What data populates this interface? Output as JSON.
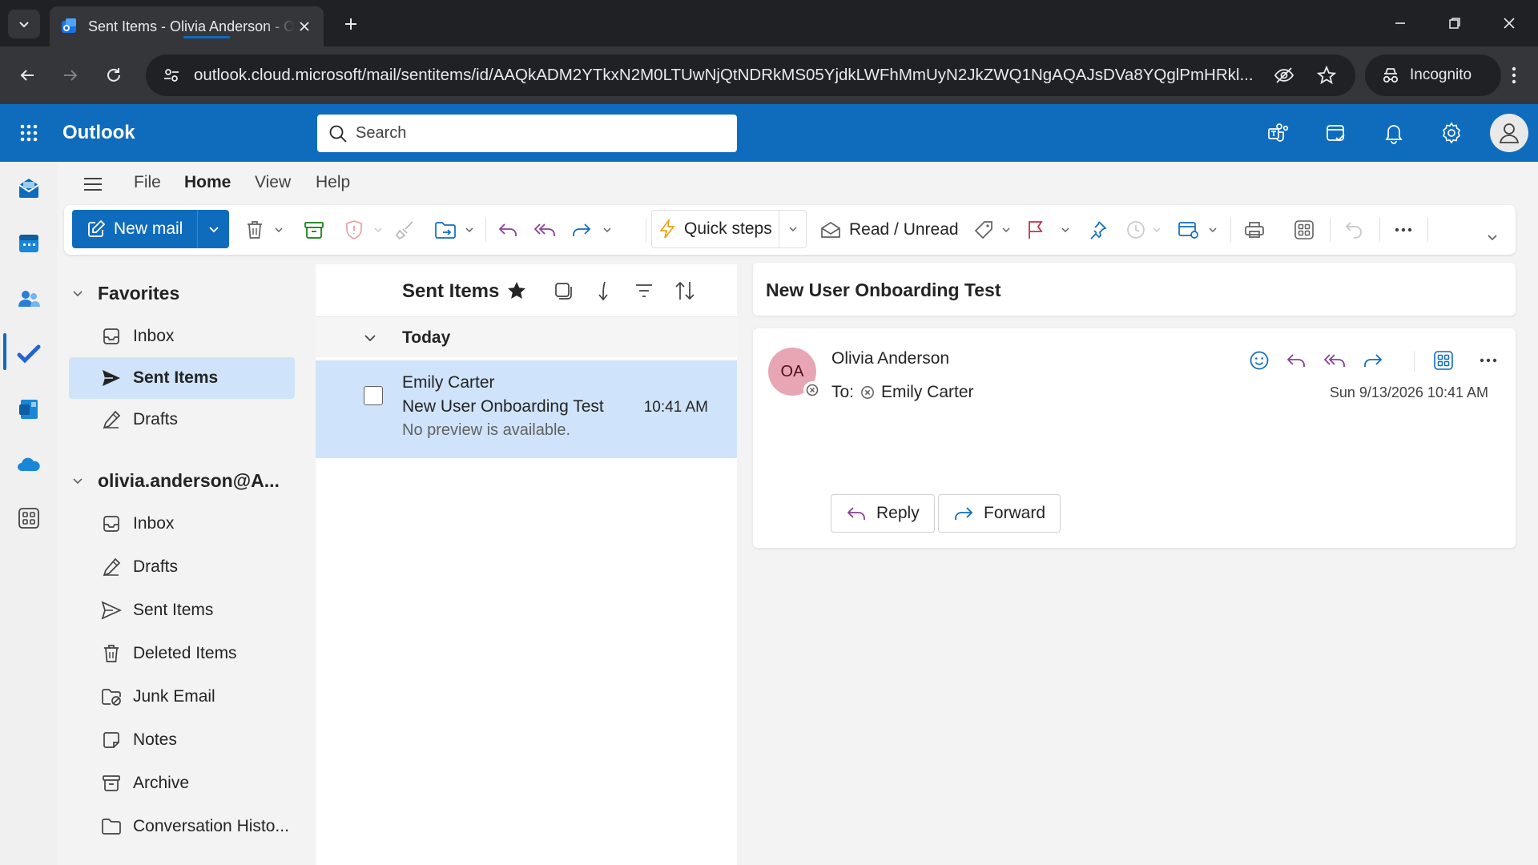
{
  "browser": {
    "tab_title": "Sent Items - Olivia Anderson - Outlook",
    "url": "outlook.cloud.microsoft/mail/sentitems/id/AAQkADM2YTkxN2M0LTUwNjQtNDRkMS05YjdkLWFhMmUyN2JkZWQ1NgAQAJsDVa8YQglPmHRkl...",
    "incognito_label": "Incognito"
  },
  "outlook": {
    "brand": "Outlook",
    "search_placeholder": "Search"
  },
  "menu": {
    "tabs": [
      "File",
      "Home",
      "View",
      "Help"
    ],
    "active": "Home"
  },
  "ribbon": {
    "new_mail": "New mail",
    "quick_steps": "Quick steps",
    "read_unread": "Read / Unread"
  },
  "folders": {
    "favorites_label": "Favorites",
    "favorites": [
      "Inbox",
      "Sent Items",
      "Drafts"
    ],
    "account_label": "olivia.anderson@A...",
    "account_folders": [
      "Inbox",
      "Drafts",
      "Sent Items",
      "Deleted Items",
      "Junk Email",
      "Notes",
      "Archive",
      "Conversation Histo..."
    ],
    "selected": "Sent Items"
  },
  "message_list": {
    "title": "Sent Items",
    "group": "Today",
    "messages": [
      {
        "from": "Emily Carter",
        "subject": "New User Onboarding Test",
        "preview": "No preview is available.",
        "time": "10:41 AM"
      }
    ]
  },
  "reading_pane": {
    "subject": "New User Onboarding Test",
    "avatar_initials": "OA",
    "sender": "Olivia Anderson",
    "to_label": "To:",
    "recipient": "Emily Carter",
    "date": "Sun 9/13/2026 10:41 AM",
    "reply_label": "Reply",
    "forward_label": "Forward"
  },
  "colors": {
    "brand_blue": "#0f6cbd",
    "selection": "#cfe4fa",
    "avatar_bg": "#e8a6b4",
    "reply_purple": "#8a3f97"
  }
}
